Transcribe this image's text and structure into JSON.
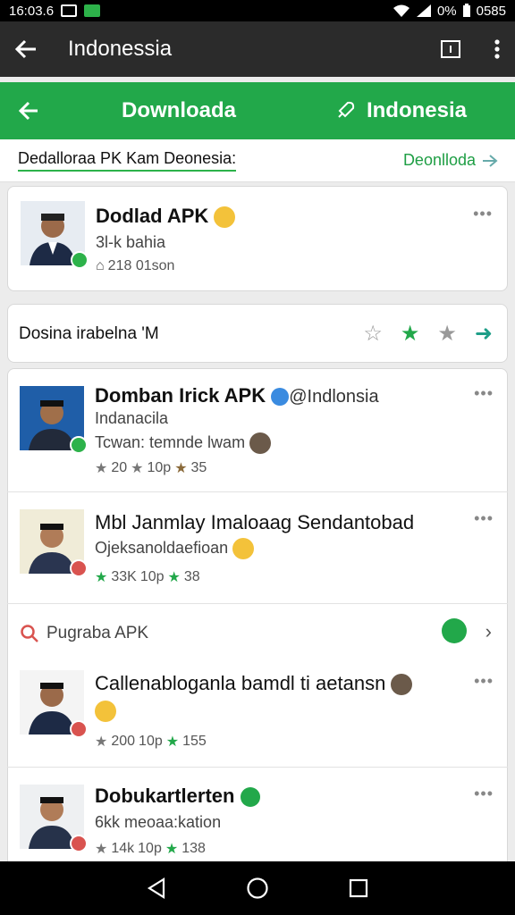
{
  "status_bar": {
    "time": "16:03.6",
    "battery_text": "0%",
    "right_time": "0585"
  },
  "app_bar": {
    "title": "Indonessia"
  },
  "green_bar": {
    "tab_left": "Downloada",
    "tab_right": "Indonesia"
  },
  "sub_bar": {
    "label": "Dedalloraa PK Kam Deonesia:",
    "right_label": "Deonlloda"
  },
  "cards": [
    {
      "title": "Dodlad APK",
      "subtitle": "3l-k bahia",
      "meta": "218 01son"
    },
    {
      "filter_label": "Dosina irabelna 'M"
    },
    {
      "title": "Domban Irick APK",
      "mention": "@Indlonsia",
      "subtitle": "Indanacila",
      "line3": "Tcwan: temnde lwam",
      "meta_count": "20",
      "meta_stars": "10p",
      "meta_rating": "35"
    },
    {
      "title": "Mbl Janmlay Imaloaag Sendantobad",
      "subtitle": "Ojeksanoldaefioan",
      "meta_count": "33K",
      "meta_stars": "10p",
      "meta_rating": "38"
    },
    {
      "search_label": "Pugraba APK"
    },
    {
      "title": "Callenabloganla bamdl ti aetansn",
      "meta_count": "200",
      "meta_stars": "10p",
      "meta_rating": "155"
    },
    {
      "title": "Dobukartlerten",
      "subtitle": "6kk meoaa:kation",
      "meta_count": "14k",
      "meta_stars": "10p",
      "meta_rating": "138"
    }
  ],
  "icons": {
    "back": "arrow-left-icon",
    "window": "window-icon",
    "more": "more-vert-icon",
    "star": "star-icon",
    "chevron": "chevron-right-icon",
    "search": "search-icon",
    "home": "home-circle-icon",
    "recent": "square-icon",
    "nav_back": "triangle-back-icon"
  },
  "colors": {
    "green": "#22a84a",
    "dark": "#2b2b2b",
    "black": "#000000"
  }
}
